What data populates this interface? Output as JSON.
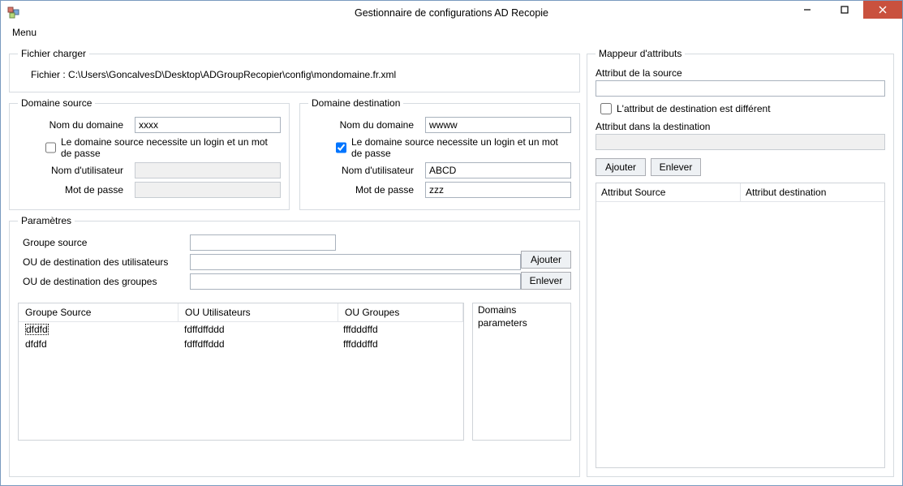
{
  "window": {
    "title": "Gestionnaire de configurations AD Recopie"
  },
  "menubar": {
    "menu": "Menu"
  },
  "fileLoader": {
    "legend": "Fichier charger",
    "label": "Fichier :",
    "path": "C:\\Users\\GoncalvesD\\Desktop\\ADGroupRecopier\\config\\mondomaine.fr.xml"
  },
  "sourceDomain": {
    "legend": "Domaine source",
    "domainLabel": "Nom du domaine",
    "domainValue": "xxxx",
    "requiresLoginLabel": "Le domaine source necessite un login et un mot de passe",
    "requiresLogin": false,
    "userLabel": "Nom d'utilisateur",
    "userValue": "",
    "passLabel": "Mot de passe",
    "passValue": ""
  },
  "destDomain": {
    "legend": "Domaine destination",
    "domainLabel": "Nom du domaine",
    "domainValue": "wwww",
    "requiresLoginLabel": "Le domaine source necessite un login et un mot de passe",
    "requiresLogin": true,
    "userLabel": "Nom d'utilisateur",
    "userValue": "ABCD",
    "passLabel": "Mot de passe",
    "passValue": "zzz"
  },
  "params": {
    "legend": "Paramètres",
    "groupSourceLabel": "Groupe source",
    "groupSourceValue": "",
    "ouUsersLabel": "OU de destination des utilisateurs",
    "ouUsersValue": "",
    "ouGroupsLabel": "OU de destination des groupes",
    "ouGroupsValue": "",
    "addBtn": "Ajouter",
    "removeBtn": "Enlever",
    "cols": {
      "a": "Groupe Source",
      "b": "OU Utilisateurs",
      "c": "OU Groupes"
    },
    "rows": [
      {
        "a": "dfdfd",
        "b": "fdffdffddd",
        "c": "fffdddffd"
      },
      {
        "a": "dfdfd",
        "b": "fdffdffddd",
        "c": "fffdddffd"
      }
    ],
    "sideList": [
      "Domains",
      "parameters"
    ]
  },
  "mapper": {
    "legend": "Mappeur d'attributs",
    "srcAttrLabel": "Attribut de la source",
    "srcAttrValue": "",
    "diffLabel": "L'attribut de destination est différent",
    "diffChecked": false,
    "dstAttrLabel": "Attribut dans la destination",
    "dstAttrValue": "",
    "addBtn": "Ajouter",
    "removeBtn": "Enlever",
    "col1": "Attribut Source",
    "col2": "Attribut destination"
  }
}
